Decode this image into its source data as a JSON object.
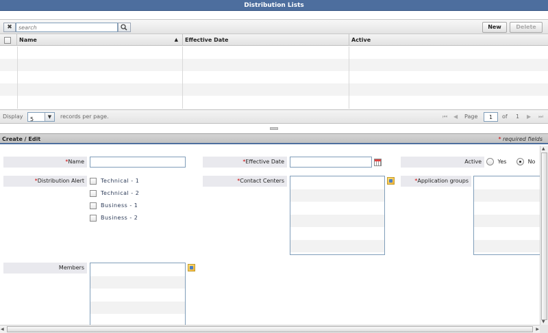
{
  "window": {
    "title": "Distribution Lists"
  },
  "toolbar": {
    "clear_label": "✖",
    "search_placeholder": "search",
    "new_label": "New",
    "delete_label": "Delete"
  },
  "grid": {
    "columns": [
      "Name",
      "Effective Date",
      "Active"
    ],
    "sort_indicator": "▲"
  },
  "pager": {
    "display_label": "Display",
    "per_page_value": "5",
    "records_label": "records per page.",
    "page_label": "Page",
    "current_page": "1",
    "of_label": "of",
    "total_pages": "1"
  },
  "form": {
    "section_title": "Create / Edit",
    "required_marker": "*",
    "required_note": "required fields",
    "name_label": "Name",
    "effective_date_label": "Effective Date",
    "active_label": "Active",
    "active_yes": "Yes",
    "active_no": "No",
    "active_selected": "No",
    "distribution_alert_label": "Distribution Alert",
    "distribution_alert_options": [
      "Technical - 1",
      "Technical - 2",
      "Business - 1",
      "Business - 2"
    ],
    "contact_centers_label": "Contact Centers",
    "application_groups_label": "Application groups",
    "members_label": "Members"
  },
  "colors": {
    "title_bar": "#4d6e9e",
    "required": "#cc0000"
  }
}
